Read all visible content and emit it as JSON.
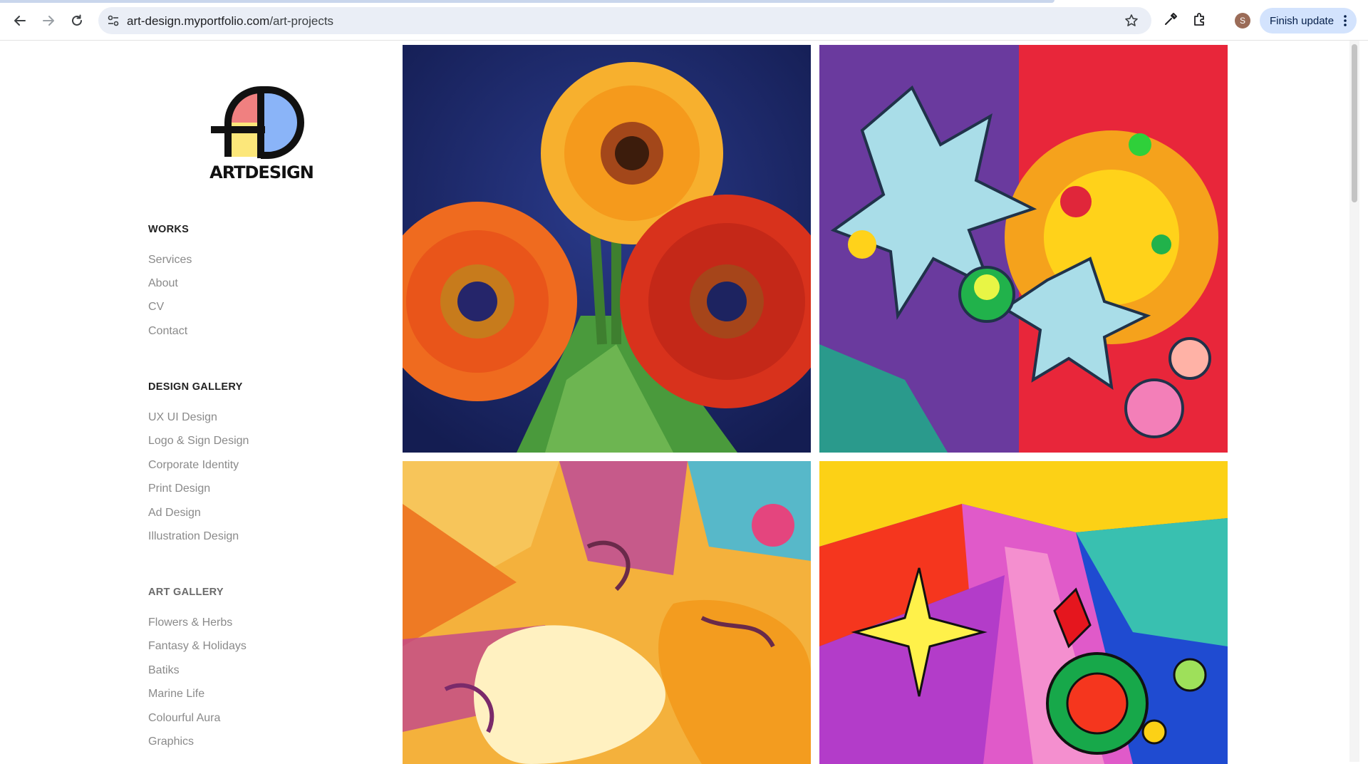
{
  "browser": {
    "url_host": "art-design.myportfolio.com",
    "url_path": "/art-projects",
    "profile_initial": "S",
    "finish_update_label": "Finish update"
  },
  "site": {
    "logo_text": "ARTDESIGN",
    "logo_colors": {
      "red": "#f08080",
      "blue": "#8ab4f8",
      "yellow": "#fce77a",
      "ink": "#111111"
    }
  },
  "sidebar": {
    "works": {
      "heading": "WORKS",
      "items": [
        "Services",
        "About",
        "CV",
        "Contact"
      ]
    },
    "design_gallery": {
      "heading": "DESIGN GALLERY",
      "items": [
        "UX UI Design",
        "Logo & Sign Design",
        "Corporate Identity",
        "Print Design",
        "Ad Design",
        "Illustration Design"
      ]
    },
    "art_gallery": {
      "heading": "ART GALLERY",
      "items": [
        "Flowers & Herbs",
        "Fantasy & Holidays",
        "Batiks",
        "Marine Life",
        "Colourful Aura",
        "Graphics"
      ]
    }
  },
  "gallery": {
    "tiles": [
      {
        "subject": "orange and red gerbera daisies in a glass vase on dark blue",
        "palette": [
          "#1e2c6e",
          "#f5a623",
          "#e8531c",
          "#c7281b",
          "#4a8f3a"
        ]
      },
      {
        "subject": "psychedelic abstract with light blue splash shapes and jewels",
        "palette": [
          "#7b3fa0",
          "#a9dde8",
          "#ffd21a",
          "#e6262e",
          "#24b24b"
        ]
      },
      {
        "subject": "batik-style swirling abstract in warm tones",
        "palette": [
          "#f59b2a",
          "#f4d35e",
          "#c2478c",
          "#52b6c9",
          "#fff1c1"
        ]
      },
      {
        "subject": "vivid pop-art abstract with starburst and gems",
        "palette": [
          "#f5361e",
          "#fcd116",
          "#1f4bd1",
          "#e05ac9",
          "#17a84a"
        ]
      }
    ]
  }
}
